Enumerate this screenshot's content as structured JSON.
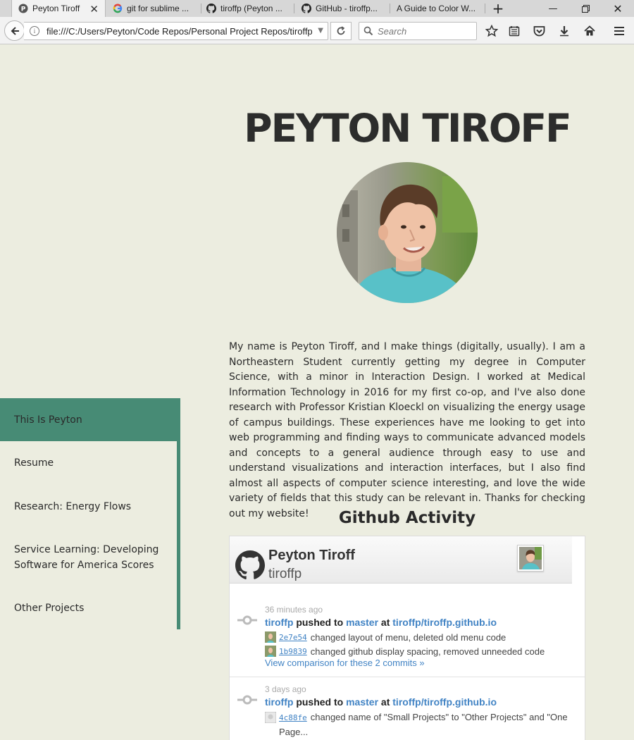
{
  "browser": {
    "tabs": [
      {
        "label": "Peyton Tiroff",
        "icon": "site-p-icon",
        "active": true
      },
      {
        "label": "git for sublime ...",
        "icon": "google-icon",
        "active": false
      },
      {
        "label": "tiroffp (Peyton ...",
        "icon": "github-icon",
        "active": false
      },
      {
        "label": "GitHub - tiroffp...",
        "icon": "github-icon",
        "active": false
      },
      {
        "label": "A Guide to Color W...",
        "icon": "none",
        "active": false
      }
    ],
    "url": "file:///C:/Users/Peyton/Code Repos/Personal Project Repos/tiroffp.github.io/index.html",
    "search_placeholder": "Search",
    "toolbar_icons": [
      "bookmark-star-icon",
      "reading-list-icon",
      "pocket-icon",
      "download-icon",
      "home-icon",
      "menu-icon"
    ]
  },
  "page": {
    "title": "PEYTON TIROFF",
    "bio": "My name is Peyton Tiroff, and I make things (digitally, usually). I am a Northeastern Student currently getting my degree in Computer Science, with a minor in Interaction Design. I worked at Medical Information Technology in 2016 for my first co-op, and I've also done research with Professor Kristian Kloeckl on visualizing the energy usage of campus buildings. These experiences have me looking to get into web programming and finding ways to communicate advanced models and concepts to a general audience through easy to use and understand visualizations and interaction interfaces, but I also find almost all aspects of computer science interesting, and love the wide variety of fields that this study can be relevant in. Thanks for checking out my website!",
    "menu": [
      {
        "label": "This Is Peyton",
        "active": true
      },
      {
        "label": "Resume",
        "active": false
      },
      {
        "label": "Research: Energy Flows",
        "active": false
      },
      {
        "label": "Service Learning: Developing Software for America Scores",
        "active": false
      },
      {
        "label": "Other Projects",
        "active": false
      }
    ],
    "github_heading": "Github Activity",
    "accent_color": "#478b75",
    "background_color": "#ecede0"
  },
  "github": {
    "name": "Peyton Tiroff",
    "login": "tiroffp",
    "events": [
      {
        "time": "36 minutes ago",
        "user": "tiroffp",
        "action": "pushed to",
        "branch": "master",
        "at": "at",
        "repo": "tiroffp/tiroffp.github.io",
        "commits": [
          {
            "sha": "2e7e54",
            "message": "changed layout of menu, deleted old menu code"
          },
          {
            "sha": "1b9839",
            "message": "changed github display spacing, removed unneeded code"
          }
        ],
        "compare": "View comparison for these 2 commits »"
      },
      {
        "time": "3 days ago",
        "user": "tiroffp",
        "action": "pushed to",
        "branch": "master",
        "at": "at",
        "repo": "tiroffp/tiroffp.github.io",
        "commits": [
          {
            "sha": "4c88fe",
            "message": "changed name of \"Small Projects\" to \"Other Projects\" and \"One Page..."
          }
        ]
      }
    ]
  }
}
